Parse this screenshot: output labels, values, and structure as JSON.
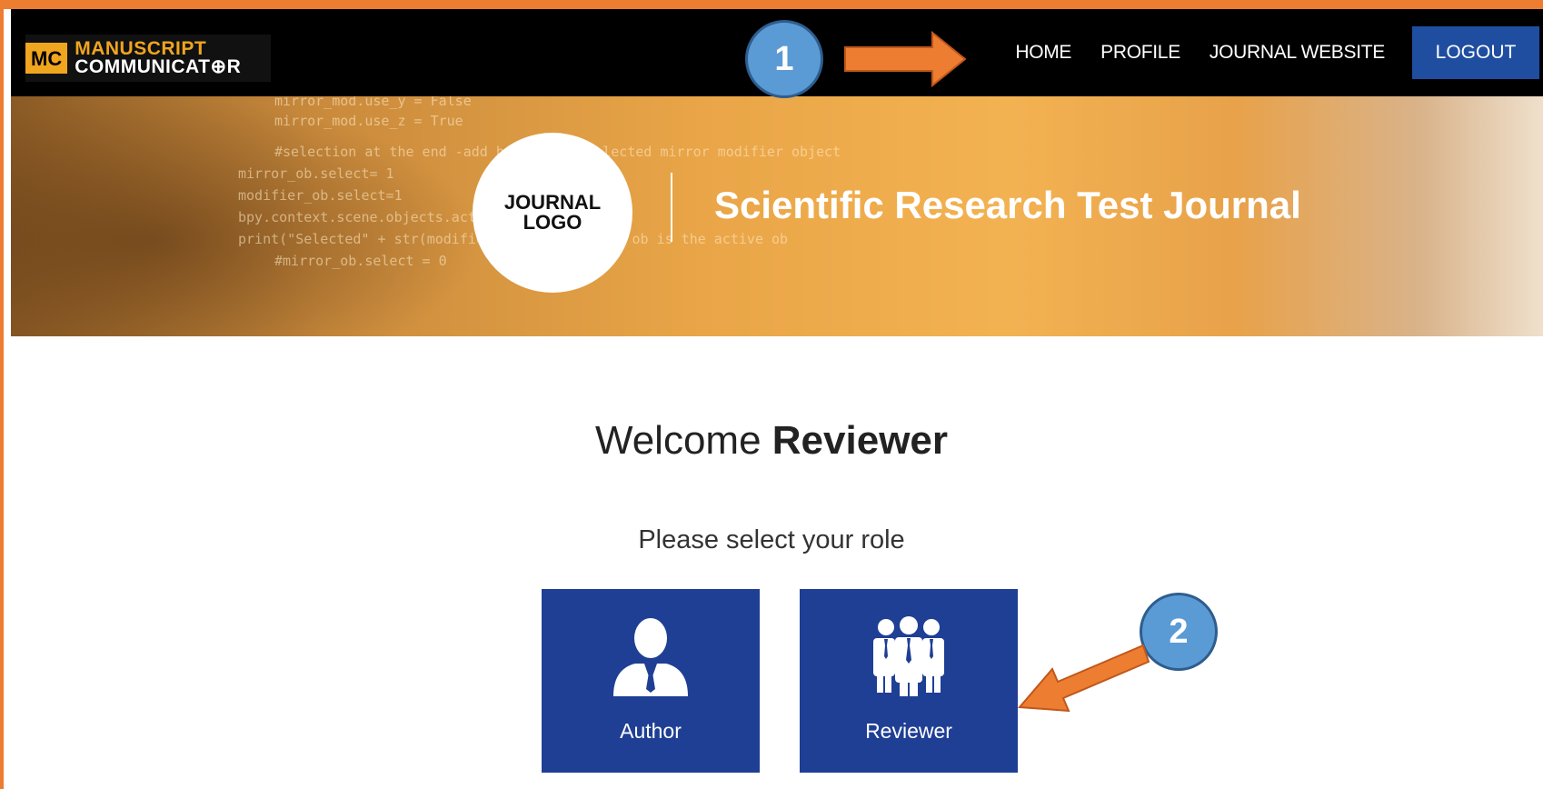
{
  "brand": {
    "mc": "MC",
    "line1": "MANUSCRIPT",
    "line2": "COMMUNICAT⊕R"
  },
  "nav": {
    "home": "HOME",
    "profile": "PROFILE",
    "journal_website": "JOURNAL WEBSITE",
    "logout": "LOGOUT"
  },
  "banner": {
    "logo_line1": "JOURNAL",
    "logo_line2": "LOGO",
    "title": "Scientific Research Test Journal",
    "code_lines": [
      "mirror_mod.use_y = False",
      "mirror_mod.use_z = True",
      "#selection at the end -add back the deselected mirror modifier object",
      "mirror_ob.select= 1",
      "modifier_ob.select=1",
      "bpy.context.scene.objects.active = modifier_ob",
      "print(\"Selected\" + str(modifier_ob)) # modifier ob is the active ob",
      "#mirror_ob.select = 0"
    ]
  },
  "welcome": {
    "prefix": "Welcome ",
    "role": "Reviewer"
  },
  "select_role": "Please select your role",
  "roles": {
    "author": "Author",
    "reviewer": "Reviewer"
  },
  "annotations": {
    "step1": "1",
    "step2": "2"
  },
  "colors": {
    "frame": "#ed7d31",
    "navbar": "#000000",
    "logout_bg": "#1f4ea1",
    "card_bg": "#1f3f95",
    "badge": "#5b9bd5",
    "arrow": "#ed7d31"
  },
  "icons": {
    "author": "person-icon",
    "reviewer": "group-icon"
  }
}
